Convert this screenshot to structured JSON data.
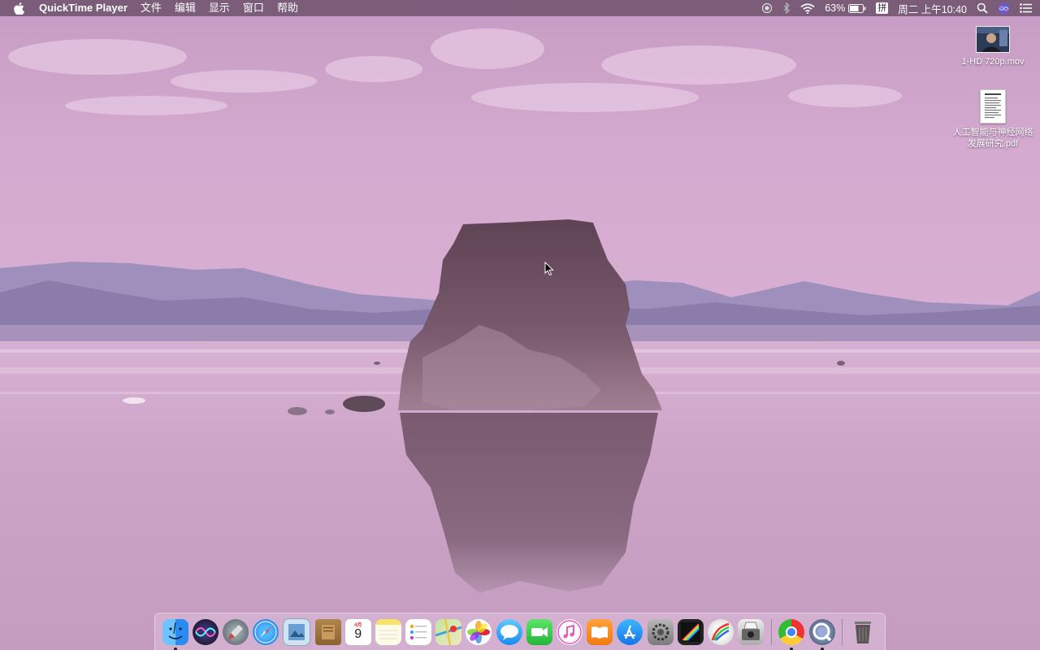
{
  "menubar": {
    "app_name": "QuickTime Player",
    "menus": [
      "文件",
      "编辑",
      "显示",
      "窗口",
      "帮助"
    ],
    "battery_percent": "63%",
    "input_method": "拼",
    "clock": "周二 上午10:40"
  },
  "desktop_files": [
    {
      "label": "1-HD 720p.mov",
      "kind": "movie"
    },
    {
      "label": "人工智能与神经网络发展研究.pdf",
      "kind": "pdf"
    }
  ],
  "dock": {
    "calendar_day": "9",
    "calendar_month": "4月",
    "apps": [
      "Finder",
      "Siri",
      "Launchpad",
      "Safari",
      "Preview",
      "Notefile",
      "Calendar",
      "Notes",
      "Reminders",
      "Maps",
      "Photos",
      "Messages",
      "FaceTime",
      "iTunes",
      "iBooks",
      "App Store",
      "System Preferences",
      "Final Cut Pro",
      "Pixelmator",
      "Preview Scanner",
      "Google Chrome",
      "QuickTime Player",
      "Trash"
    ]
  },
  "colors": {
    "sky": "#cfa6cc",
    "mountains": "#8b7fae",
    "water": "#d4acd0",
    "rock": "#6e4e62"
  }
}
